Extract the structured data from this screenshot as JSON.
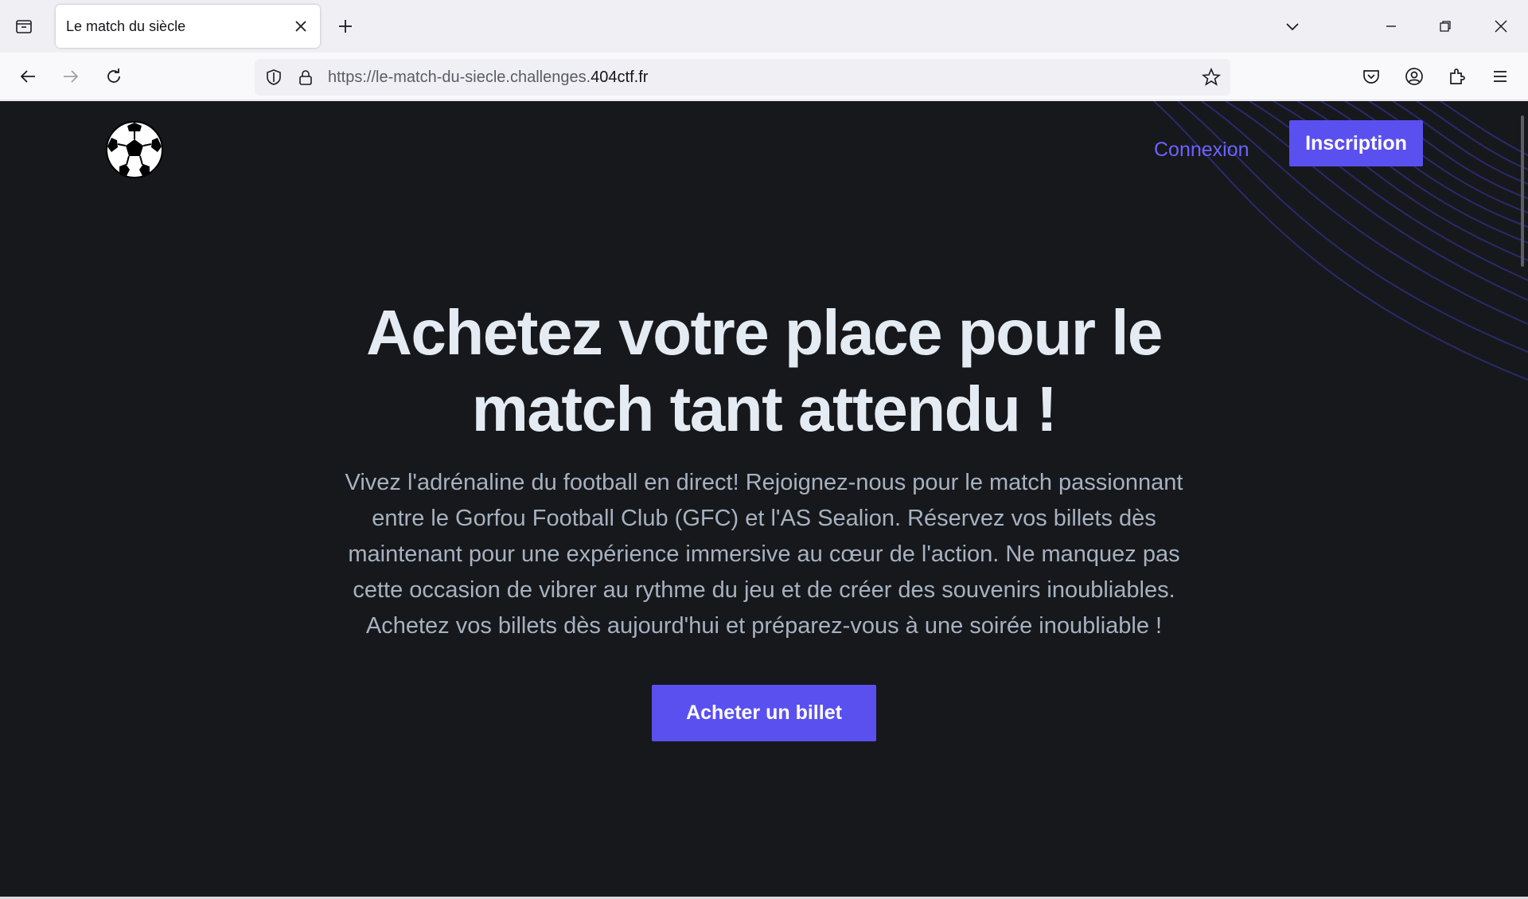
{
  "browser": {
    "tab_title": "Le match du siècle",
    "url_prefix": "https://le-match-du-siecle.challenges.",
    "url_domain": "404ctf.fr"
  },
  "site": {
    "nav": {
      "login_label": "Connexion",
      "signup_label": "Inscription"
    },
    "hero": {
      "title_line1": "Achetez votre place pour le",
      "title_line2": "match tant attendu !",
      "text_lines": [
        "Vivez l'adrénaline du football en direct! Rejoignez-nous pour le match passionnant",
        "entre le Gorfou Football Club (GFC) et l'AS Sealion. Réservez vos billets dès",
        "maintenant pour une expérience immersive au cœur de l'action. Ne manquez pas",
        "cette occasion de vibrer au rythme du jeu et de créer des souvenirs inoubliables.",
        "Achetez vos billets dès aujourd'hui et préparez-vous à une soirée inoubliable !"
      ],
      "cta_label": "Acheter un billet"
    }
  },
  "colors": {
    "page_background": "#17181c",
    "accent": "#5a50f0",
    "link": "#6c63ff",
    "heading": "#e4ebf2",
    "body_text": "#a6b2c0"
  },
  "icons": [
    "tab-overview-icon",
    "close-icon",
    "new-tab-icon",
    "chevron-down-icon",
    "minimize-icon",
    "restore-icon",
    "window-close-icon",
    "back-icon",
    "forward-icon",
    "reload-icon",
    "shield-icon",
    "lock-icon",
    "star-icon",
    "pocket-icon",
    "account-icon",
    "extensions-icon",
    "menu-icon",
    "soccer-ball-icon"
  ]
}
